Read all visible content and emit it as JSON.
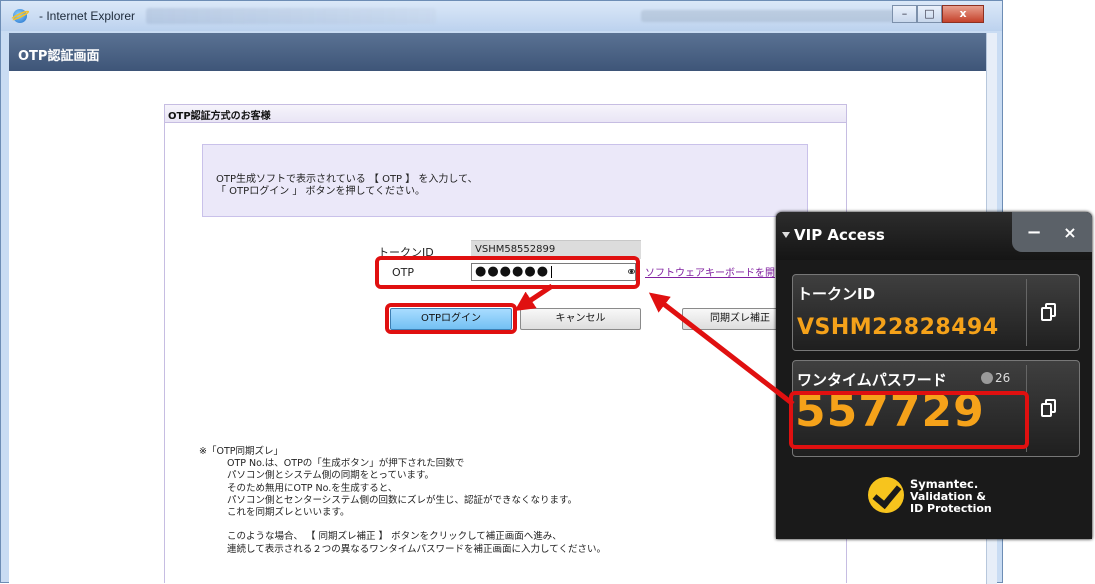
{
  "browser": {
    "title": "- Internet Explorer",
    "controls": {
      "minimize": "–",
      "maximize": "□",
      "close": "x"
    }
  },
  "page": {
    "header_title": "OTP認証画面",
    "form_title": "OTP認証方式のお客様",
    "instructions": [
      "OTP生成ソフトで表示されている 【 OTP 】 を入力して、",
      "「 OTPログイン 」 ボタンを押してください。"
    ],
    "token_id_label": "トークンID",
    "token_id_value": "VSHM58552899",
    "otp_label": "OTP",
    "otp_value": "●●●●●●",
    "software_keyboard_link": "ソフトウェアキーボードを開",
    "buttons": {
      "login": "OTPログイン",
      "cancel": "キャンセル",
      "sync": "同期ズレ補正"
    },
    "notes": [
      "※「OTP同期ズレ」",
      "OTP No.は、OTPの「生成ボタン」が押下された回数で",
      "パソコン側とシステム側の同期をとっています。",
      "そのため無用にOTP No.を生成すると、",
      "パソコン側とセンターシステム側の回数にズレが生じ、認証ができなくなります。",
      "これを同期ズレといいます。",
      "",
      "このような場合、 【 同期ズレ補正 】 ボタンをクリックして補正画面へ進み、",
      "連続して表示される２つの異なるワンタイムパスワードを補正画面に入力してください。"
    ]
  },
  "vip_access": {
    "title": "VIP Access",
    "minimize": "−",
    "close": "×",
    "token_label": "トークンID",
    "token_value": "VSHM22828494",
    "password_label": "ワンタイムパスワード",
    "timer": "26",
    "password_value": "557729",
    "brand_line1": "Symantec.",
    "brand_line2": "Validation &",
    "brand_line3": "ID Protection",
    "colors": {
      "accent": "#f5a21a",
      "highlight": "#e01010"
    }
  }
}
